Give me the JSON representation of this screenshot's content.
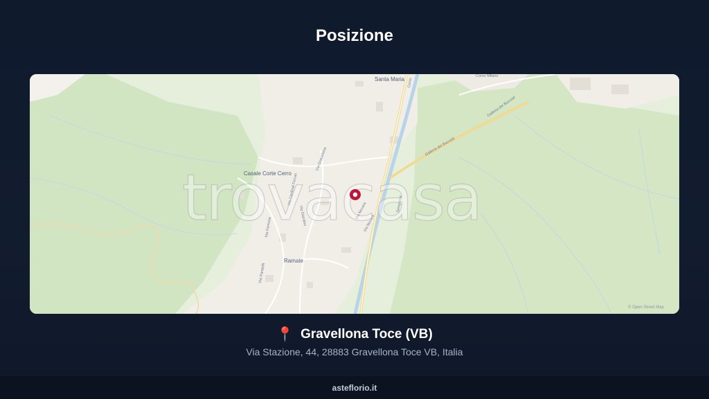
{
  "header": {
    "title": "Posizione"
  },
  "map": {
    "watermark": "trovacasa",
    "attribution": "© Open Street Map",
    "places": {
      "santa_maria": "Santa Maria",
      "casale_corte_cerro": "Casale Corte Cerro",
      "ramate": "Ramate"
    },
    "roads": {
      "corso_milano": "Corso Milano",
      "galleria_bucciol": "Galleria dei Buccioli",
      "galleria_bucciol_2": "Galleria dei Buccioli",
      "via_novara": "Via Novara",
      "via_novara_2": "Via Novara",
      "via_gravellona": "Via Gravellona",
      "via_roma": "Via Roma",
      "via_sempione": "Sempione",
      "via_cardinal": "Via Cardinal Ferrari",
      "via_tor": "Via Ferrovia",
      "via_pandolfi": "Via Pandolfi",
      "via_giardino": "Via Giardino",
      "corso_2": "Corso"
    },
    "marker_color": "#c0143c",
    "colors": {
      "forest": "#cfe3bf",
      "urban": "#f2efe9",
      "river": "#b8d4e8",
      "main_road": "#f6d98b"
    }
  },
  "location": {
    "pin_icon": "round-pushpin-icon",
    "name": "Gravellona Toce (VB)",
    "address": "Via Stazione, 44, 28883 Gravellona Toce VB, Italia"
  },
  "footer": {
    "brand": "asteflorio.it"
  }
}
